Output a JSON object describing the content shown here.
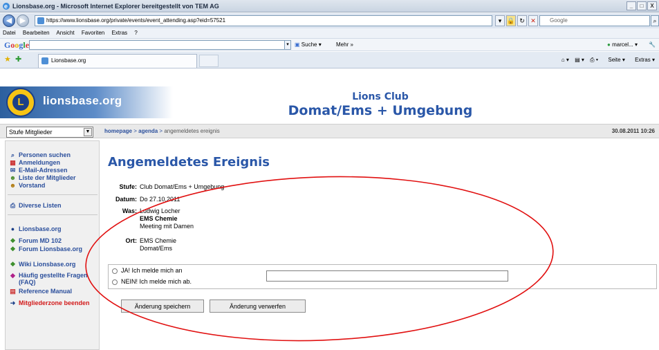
{
  "window": {
    "title": "Lionsbase.org - Microsoft Internet Explorer bereitgestellt von TEM AG",
    "controls": [
      "_",
      "□",
      "X"
    ]
  },
  "address_bar": {
    "url": "https://www.lionsbase.org/private/events/event_attending.asp?eid=57521",
    "search_placeholder": "Google"
  },
  "menu": [
    "Datei",
    "Bearbeiten",
    "Ansicht",
    "Favoriten",
    "Extras",
    "?"
  ],
  "google_toolbar": {
    "logo": "Google",
    "search_label": "Suche",
    "more_label": "Mehr »",
    "user": "marcel..."
  },
  "tabs": {
    "active": "Lionsbase.org",
    "tools": [
      "Seite",
      "Extras"
    ]
  },
  "banner": {
    "logo_text": "lionsbase.org",
    "emblem_letter": "L",
    "club_type": "Lions Club",
    "club_name": "Domat/Ems + Umgebung"
  },
  "crumbbar": {
    "level_select": "Stufe Mitglieder",
    "breadcrumb": [
      "homepage",
      "agenda",
      "angemeldetes ereignis"
    ],
    "separator": ">",
    "datetime": "30.08.2011 10:26"
  },
  "sidebar": {
    "group1": [
      {
        "label": "Personen suchen",
        "icon": "magnifier-icon"
      },
      {
        "label": "Anmeldungen",
        "icon": "calendar-icon"
      },
      {
        "label": "E-Mail-Adressen",
        "icon": "contacts-icon"
      },
      {
        "label": "Liste der Mitglieder",
        "icon": "members-icon"
      },
      {
        "label": "Vorstand",
        "icon": "board-icon"
      }
    ],
    "group2": [
      {
        "label": "Diverse Listen",
        "icon": "print-icon"
      }
    ],
    "group3": [
      {
        "label": "Lionsbase.org",
        "icon": "lions-icon"
      },
      {
        "label": "Forum MD 102",
        "icon": "forum-icon"
      },
      {
        "label": "Forum Lionsbase.org",
        "icon": "forum-icon"
      },
      {
        "label": "Wiki Lionsbase.org",
        "icon": "forum-icon"
      },
      {
        "label": "Häufig gestellte Fragen (FAQ)",
        "icon": "faq-icon"
      },
      {
        "label": "Reference Manual",
        "icon": "manual-icon"
      },
      {
        "label": "Mitgliederzone beenden",
        "icon": "logout-icon"
      }
    ]
  },
  "event": {
    "heading": "Angemeldetes Ereignis",
    "stufe_label": "Stufe:",
    "stufe": "Club Domat/Ems + Umgebung",
    "datum_label": "Datum:",
    "datum": "Do 27.10.2011",
    "was_label": "Was:",
    "was_person": "Ludwig Locher",
    "was_title": "EMS Chemie",
    "was_note": "Meeting mit Damen",
    "ort_label": "Ort:",
    "ort_line1": "EMS Chemie",
    "ort_line2": "Domat/Ems"
  },
  "form": {
    "option_yes": "JA! Ich melde mich an",
    "option_no": "NEIN! Ich melde mich ab.",
    "comment_value": "",
    "save_button": "Änderung speichern",
    "discard_button": "Änderung verwerfen"
  },
  "colors": {
    "brand_blue": "#2a57a8",
    "annotation_red": "#e11010"
  }
}
